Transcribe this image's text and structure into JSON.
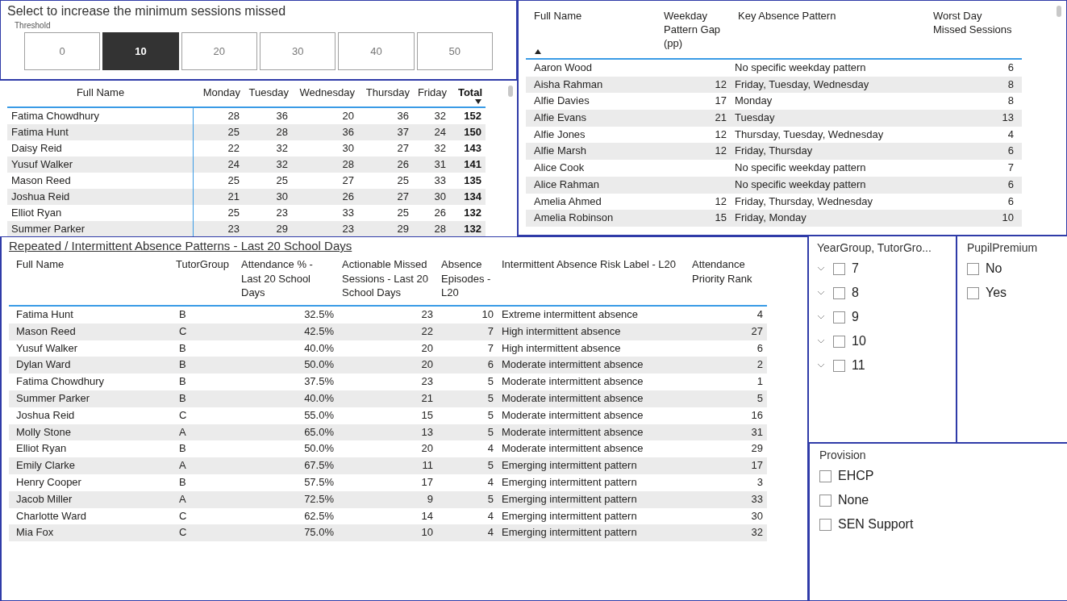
{
  "threshold": {
    "title": "Select to increase the minimum sessions missed",
    "label": "Threshold",
    "options": [
      {
        "label": "0",
        "selected": false
      },
      {
        "label": "10",
        "selected": true
      },
      {
        "label": "20",
        "selected": false
      },
      {
        "label": "30",
        "selected": false
      },
      {
        "label": "40",
        "selected": false
      },
      {
        "label": "50",
        "selected": false
      }
    ]
  },
  "weekday_table": {
    "sort_descending": true,
    "columns": [
      {
        "label": "Full Name",
        "sorted": false
      },
      {
        "label": "Monday",
        "sorted": false
      },
      {
        "label": "Tuesday",
        "sorted": false
      },
      {
        "label": "Wednesday",
        "sorted": false
      },
      {
        "label": "Thursday",
        "sorted": false
      },
      {
        "label": "Friday",
        "sorted": false
      },
      {
        "label": "Total",
        "sorted": true
      }
    ],
    "rows": [
      {
        "cells": [
          "Fatima Chowdhury",
          "28",
          "36",
          "20",
          "36",
          "32",
          "152"
        ]
      },
      {
        "cells": [
          "Fatima Hunt",
          "25",
          "28",
          "36",
          "37",
          "24",
          "150"
        ]
      },
      {
        "cells": [
          "Daisy Reid",
          "22",
          "32",
          "30",
          "27",
          "32",
          "143"
        ]
      },
      {
        "cells": [
          "Yusuf Walker",
          "24",
          "32",
          "28",
          "26",
          "31",
          "141"
        ]
      },
      {
        "cells": [
          "Mason Reed",
          "25",
          "25",
          "27",
          "25",
          "33",
          "135"
        ]
      },
      {
        "cells": [
          "Joshua Reid",
          "21",
          "30",
          "26",
          "27",
          "30",
          "134"
        ]
      },
      {
        "cells": [
          "Elliot Ryan",
          "25",
          "23",
          "33",
          "25",
          "26",
          "132"
        ]
      },
      {
        "cells": [
          "Summer Parker",
          "23",
          "29",
          "23",
          "29",
          "28",
          "132"
        ]
      }
    ]
  },
  "pattern_table": {
    "sort_descending": false,
    "columns": [
      {
        "label": "Full Name",
        "sorted": true
      },
      {
        "label": "Weekday Pattern Gap (pp)",
        "sorted": false
      },
      {
        "label": "Key Absence Pattern",
        "sorted": false
      },
      {
        "label": "Worst Day Missed Sessions",
        "sorted": false
      }
    ],
    "rows": [
      {
        "cells": [
          "Aaron Wood",
          "",
          "No specific weekday pattern",
          "6"
        ]
      },
      {
        "cells": [
          "Aisha Rahman",
          "12",
          "Friday, Tuesday, Wednesday",
          "8"
        ]
      },
      {
        "cells": [
          "Alfie Davies",
          "17",
          "Monday",
          "8"
        ]
      },
      {
        "cells": [
          "Alfie Evans",
          "21",
          "Tuesday",
          "13"
        ]
      },
      {
        "cells": [
          "Alfie Jones",
          "12",
          "Thursday, Tuesday, Wednesday",
          "4"
        ]
      },
      {
        "cells": [
          "Alfie Marsh",
          "12",
          "Friday, Thursday",
          "6"
        ]
      },
      {
        "cells": [
          "Alice Cook",
          "",
          "No specific weekday pattern",
          "7"
        ]
      },
      {
        "cells": [
          "Alice Rahman",
          "",
          "No specific weekday pattern",
          "6"
        ]
      },
      {
        "cells": [
          "Amelia Ahmed",
          "12",
          "Friday, Thursday, Wednesday",
          "6"
        ]
      },
      {
        "cells": [
          "Amelia Robinson",
          "15",
          "Friday, Monday",
          "10"
        ]
      }
    ]
  },
  "intermittent_table": {
    "title": "Repeated / Intermittent Absence Patterns - Last 20 School Days",
    "columns": [
      {
        "label": "Full Name"
      },
      {
        "label": "TutorGroup"
      },
      {
        "label": "Attendance % - Last 20 School Days"
      },
      {
        "label": "Actionable Missed Sessions - Last 20 School Days"
      },
      {
        "label": "Absence Episodes - L20"
      },
      {
        "label": "Intermittent Absence Risk Label - L20"
      },
      {
        "label": "Attendance Priority Rank"
      }
    ],
    "rows": [
      {
        "cells": [
          "Fatima Hunt",
          "B",
          "32.5%",
          "23",
          "10",
          "Extreme intermittent absence",
          "4"
        ]
      },
      {
        "cells": [
          "Mason Reed",
          "C",
          "42.5%",
          "22",
          "7",
          "High intermittent absence",
          "27"
        ]
      },
      {
        "cells": [
          "Yusuf Walker",
          "B",
          "40.0%",
          "20",
          "7",
          "High intermittent absence",
          "6"
        ]
      },
      {
        "cells": [
          "Dylan Ward",
          "B",
          "50.0%",
          "20",
          "6",
          "Moderate intermittent absence",
          "2"
        ]
      },
      {
        "cells": [
          "Fatima Chowdhury",
          "B",
          "37.5%",
          "23",
          "5",
          "Moderate intermittent absence",
          "1"
        ]
      },
      {
        "cells": [
          "Summer Parker",
          "B",
          "40.0%",
          "21",
          "5",
          "Moderate intermittent absence",
          "5"
        ]
      },
      {
        "cells": [
          "Joshua Reid",
          "C",
          "55.0%",
          "15",
          "5",
          "Moderate intermittent absence",
          "16"
        ]
      },
      {
        "cells": [
          "Molly Stone",
          "A",
          "65.0%",
          "13",
          "5",
          "Moderate intermittent absence",
          "31"
        ]
      },
      {
        "cells": [
          "Elliot Ryan",
          "B",
          "50.0%",
          "20",
          "4",
          "Moderate intermittent absence",
          "29"
        ]
      },
      {
        "cells": [
          "Emily Clarke",
          "A",
          "67.5%",
          "11",
          "5",
          "Emerging intermittent pattern",
          "17"
        ]
      },
      {
        "cells": [
          "Henry Cooper",
          "B",
          "57.5%",
          "17",
          "4",
          "Emerging intermittent pattern",
          "3"
        ]
      },
      {
        "cells": [
          "Jacob Miller",
          "A",
          "72.5%",
          "9",
          "5",
          "Emerging intermittent pattern",
          "33"
        ]
      },
      {
        "cells": [
          "Charlotte Ward",
          "C",
          "62.5%",
          "14",
          "4",
          "Emerging intermittent pattern",
          "30"
        ]
      },
      {
        "cells": [
          "Mia Fox",
          "C",
          "75.0%",
          "10",
          "4",
          "Emerging intermittent pattern",
          "32"
        ]
      }
    ]
  },
  "year_group_slicer": {
    "title": "YearGroup, TutorGro...",
    "items": [
      {
        "label": "7",
        "checked": false,
        "expanded": false
      },
      {
        "label": "8",
        "checked": false,
        "expanded": false
      },
      {
        "label": "9",
        "checked": false,
        "expanded": false
      },
      {
        "label": "10",
        "checked": false,
        "expanded": false
      },
      {
        "label": "11",
        "checked": false,
        "expanded": false
      }
    ]
  },
  "pupil_premium_slicer": {
    "title": "PupilPremium",
    "items": [
      {
        "label": "No",
        "checked": false
      },
      {
        "label": "Yes",
        "checked": false
      }
    ]
  },
  "provision_slicer": {
    "title": "Provision",
    "items": [
      {
        "label": "EHCP",
        "checked": false
      },
      {
        "label": "None",
        "checked": false
      },
      {
        "label": "SEN Support",
        "checked": false
      }
    ]
  }
}
